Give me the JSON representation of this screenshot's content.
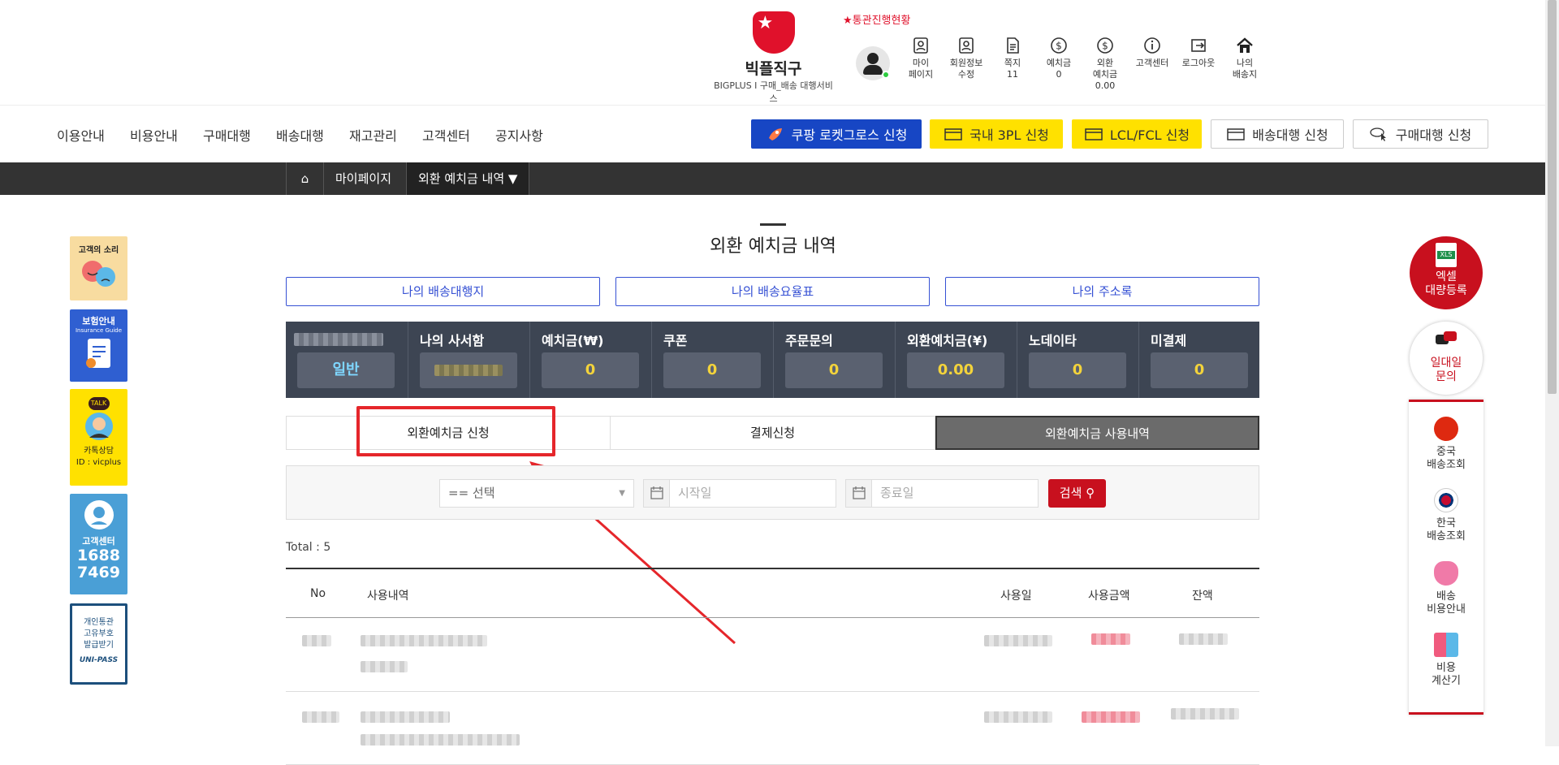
{
  "header": {
    "logo_name": "빅플직구",
    "logo_sub": "BIGPLUS I 구매_배송 대행서비스",
    "customs_link": "★통관진행현황",
    "icons": [
      {
        "name": "mypage-icon",
        "label": "마이\n페이지"
      },
      {
        "name": "member-edit-icon",
        "label": "회원정보\n수정"
      },
      {
        "name": "message-icon",
        "label": "쪽지\n11"
      },
      {
        "name": "deposit-icon",
        "label": "예치금\n0"
      },
      {
        "name": "foreign-deposit-icon",
        "label": "외환\n예치금\n0.00"
      },
      {
        "name": "info-icon",
        "label": "고객센터"
      },
      {
        "name": "logout-icon",
        "label": "로그아웃"
      },
      {
        "name": "home-icon",
        "label": "나의\n배송지"
      }
    ]
  },
  "nav": {
    "items": [
      "이용안내",
      "비용안내",
      "구매대행",
      "배송대행",
      "재고관리",
      "고객센터",
      "공지사항"
    ],
    "buttons": [
      {
        "label": "쿠팡 로켓그로스 신청",
        "bg": "#1746c4",
        "color": "#ffffff"
      },
      {
        "label": "국내 3PL 신청",
        "bg": "#ffe100",
        "color": "#333333"
      },
      {
        "label": "LCL/FCL 신청",
        "bg": "#ffe100",
        "color": "#333333"
      },
      {
        "label": "배송대행 신청",
        "bg": "#ffffff",
        "color": "#333333"
      },
      {
        "label": "구매대행 신청",
        "bg": "#ffffff",
        "color": "#333333"
      }
    ]
  },
  "breadcrumb": {
    "home": "⌂",
    "level1": "마이페이지",
    "level2": "외환 예치금 내역 ▼"
  },
  "page_title": "외환 예치금 내역",
  "top_links": [
    "나의 배송대행지",
    "나의 배송요율표",
    "나의 주소록"
  ],
  "stats": {
    "grade": "일반",
    "items": [
      {
        "label": "나의 사서함",
        "value": ""
      },
      {
        "label": "예치금(₩)",
        "value": "0"
      },
      {
        "label": "쿠폰",
        "value": "0"
      },
      {
        "label": "주문문의",
        "value": "0"
      },
      {
        "label": "외환예치금(¥)",
        "value": "0.00"
      },
      {
        "label": "노데이타",
        "value": "0"
      },
      {
        "label": "미결제",
        "value": "0"
      }
    ]
  },
  "tabs": [
    "외환예치금 신청",
    "결제신청",
    "외환예치금 사용내역"
  ],
  "filter": {
    "select": "== 선택",
    "start_placeholder": "시작일",
    "end_placeholder": "종료일",
    "search": "검색"
  },
  "table": {
    "total": "Total : 5",
    "headers": [
      "No",
      "사용내역",
      "사용일",
      "사용금액",
      "잔액"
    ]
  },
  "left_sidebar": [
    {
      "title": "고객의 소리",
      "bg": "#f8dca0"
    },
    {
      "title": "보험안내",
      "sub": "Insurance Guide",
      "bg": "#2f5fd1"
    },
    {
      "title": "카톡상담\nID : vicplus",
      "bg": "#ffe100",
      "badge": "TALK"
    },
    {
      "title": "고객센터",
      "phone": "1688\n7469",
      "bg": "#4a9fd6"
    },
    {
      "title": "개인통관\n고유부호\n발급받기",
      "sub": "UNI-PASS",
      "bg": "#ffffff"
    }
  ],
  "right_sidebar": {
    "excel": "엑셀\n대량등록",
    "excel_badge": "XLS",
    "inquiry": "일대일\n문의",
    "items": [
      "중국\n배송조회",
      "한국\n배송조회",
      "배송\n비용안내",
      "비용\n계산기"
    ]
  }
}
